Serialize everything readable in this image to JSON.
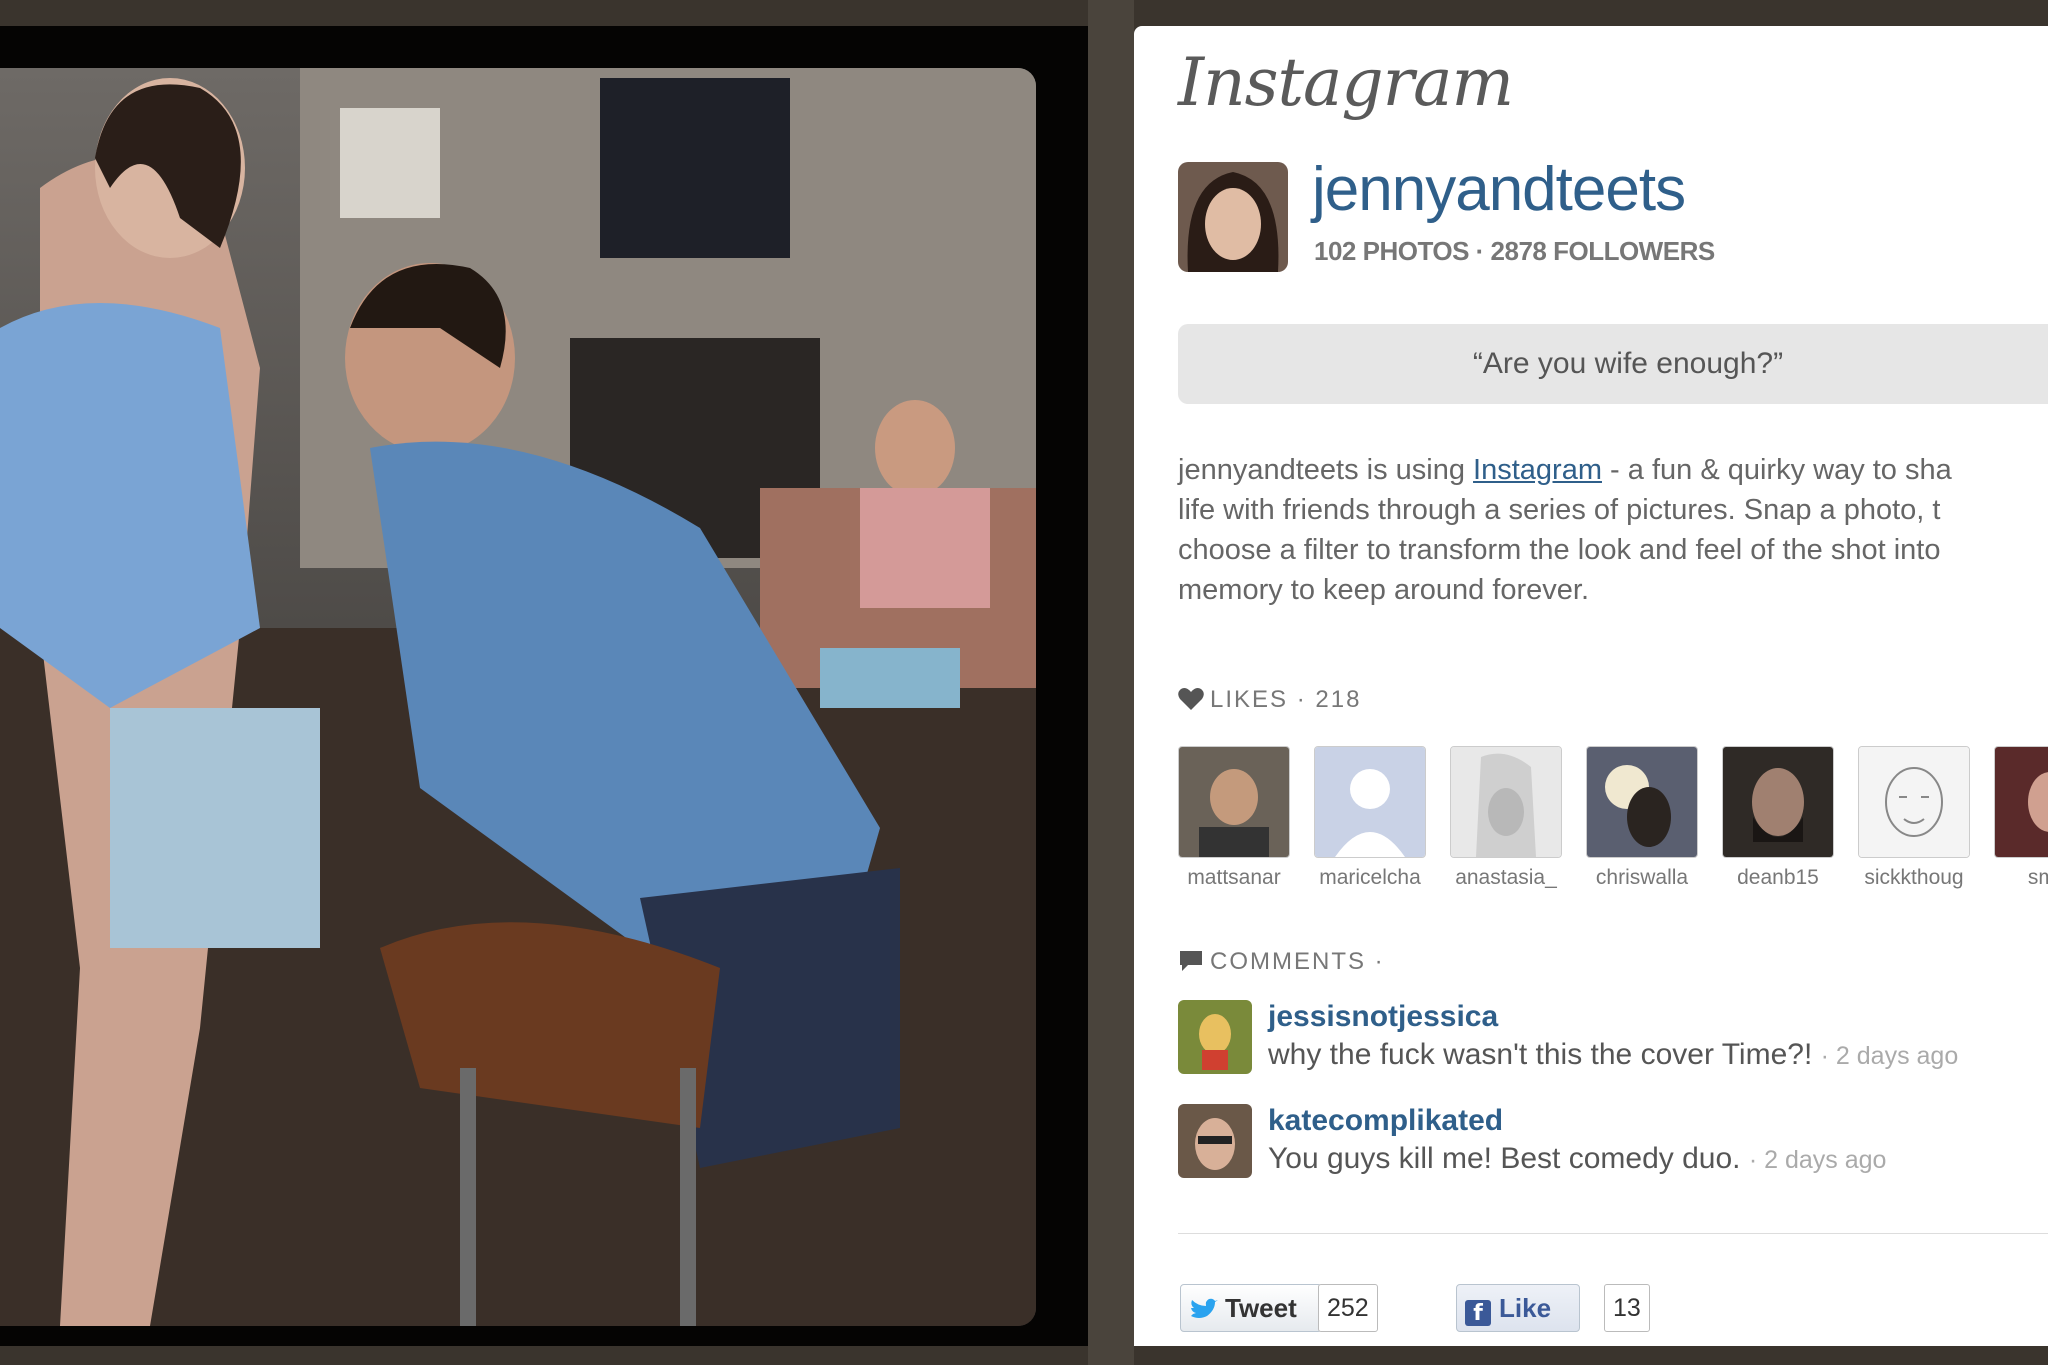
{
  "app": {
    "logo": "Instagram"
  },
  "profile": {
    "username": "jennyandteets",
    "stats": "102 PHOTOS · 2878 FOLLOWERS",
    "avatar_icon": "profile-photo"
  },
  "caption": "“Are you wife enough?”",
  "description": {
    "lines": [
      [
        "jennyandteets is using ",
        "Instagram",
        " - a fun & quirky way to sha"
      ],
      "life with friends through a series of pictures. Snap a photo, t",
      "choose a filter to transform the look and feel of the shot into",
      "memory to keep around forever."
    ]
  },
  "likes": {
    "label": "LIKES · 218",
    "icon": "heart-icon",
    "users": [
      {
        "name": "mattsanar",
        "color": "#6a6258"
      },
      {
        "name": "maricelcha",
        "color": "#c9d2e6"
      },
      {
        "name": "anastasia_",
        "color": "#e8e8e8"
      },
      {
        "name": "chriswalla",
        "color": "#5a5f70"
      },
      {
        "name": "deanb15",
        "color": "#2f2a26"
      },
      {
        "name": "sickkthoug",
        "color": "#f4f4f4"
      },
      {
        "name": "smol",
        "color": "#5a2a2a"
      }
    ]
  },
  "comments": {
    "label": "COMMENTS ·",
    "icon": "speech-bubble-icon",
    "items": [
      {
        "user": "jessisnotjessica",
        "text": "why the fuck wasn't this the cover Time?!",
        "time": "· 2 days ago",
        "color": "#7a8a3a"
      },
      {
        "user": "katecomplikated",
        "text": "You guys kill me! Best comedy duo.",
        "time": "· 2 days ago",
        "color": "#6a5848"
      }
    ]
  },
  "share": {
    "tweet_label": "Tweet",
    "tweet_count": "252",
    "like_label": "Like",
    "like_count": "13"
  },
  "colors": {
    "link": "#2f5f8a",
    "background": "#3a342d"
  }
}
